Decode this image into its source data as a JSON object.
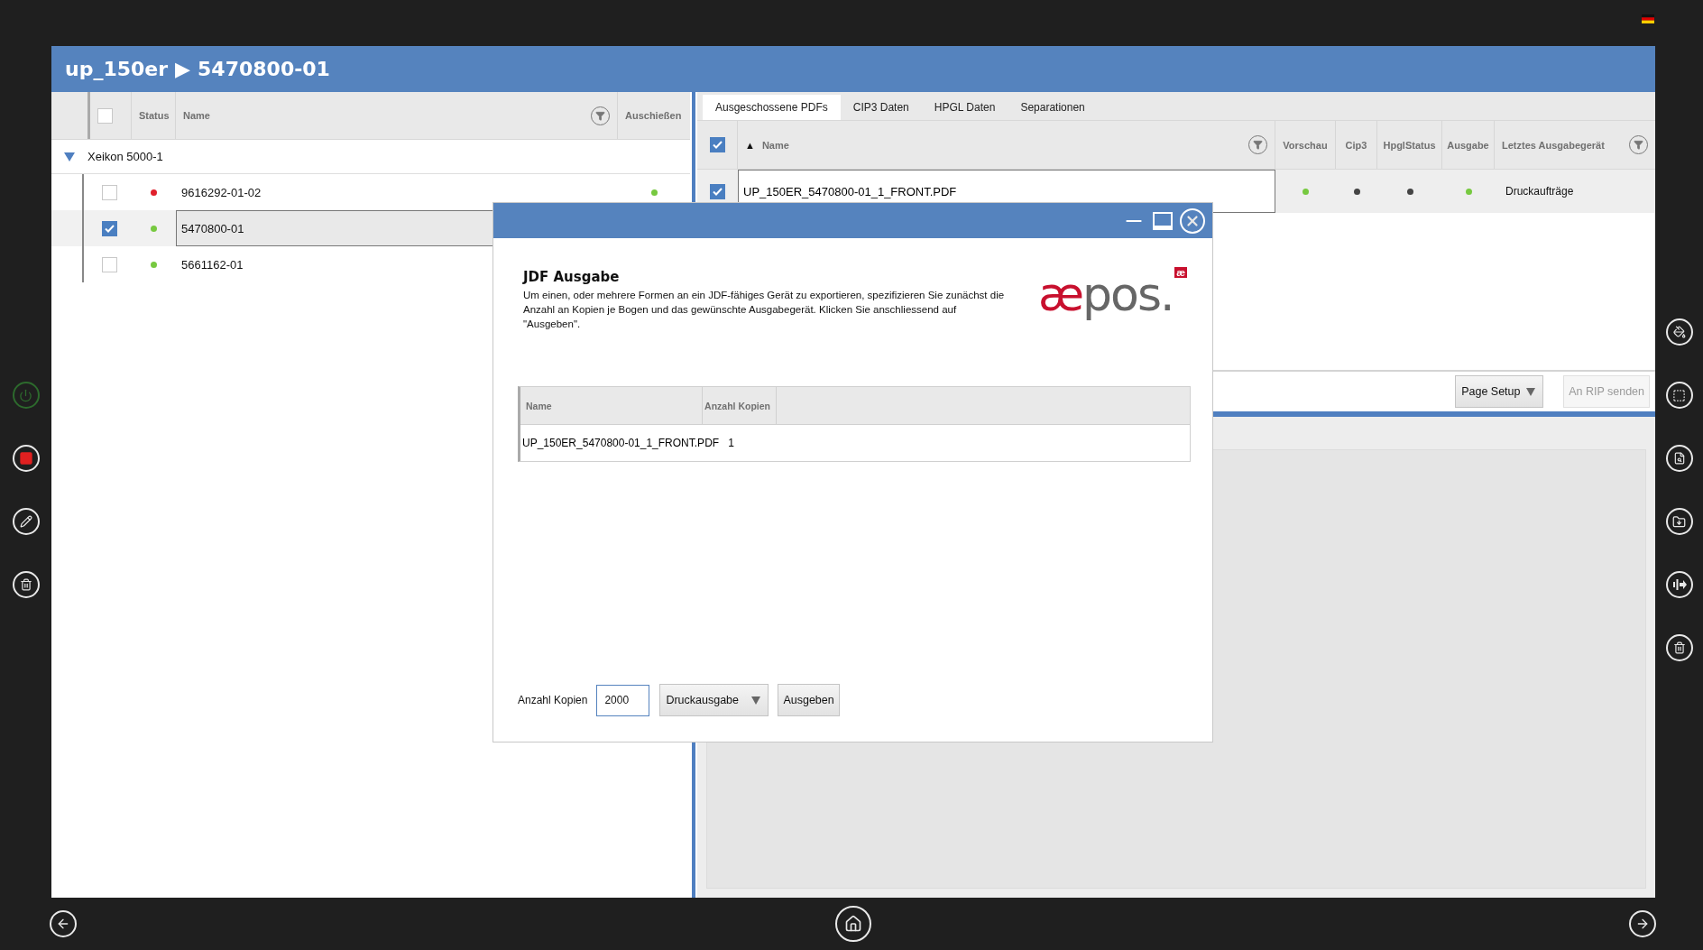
{
  "breadcrumb": {
    "project": "up_150er",
    "separator": "▶",
    "job": "5470800-01"
  },
  "left_table": {
    "all_checked": false,
    "columns": [
      "Status",
      "Name",
      "Auschießen"
    ],
    "groups": [
      {
        "name": "Xeikon 5000-1",
        "expanded": true,
        "rows": [
          {
            "checked": false,
            "color": "#e0202c",
            "name": "9616292-01-02",
            "selected": false,
            "imposed": {
              "color": "#77c940"
            }
          },
          {
            "checked": true,
            "color": "#77c940",
            "name": "5470800-01",
            "selected": true
          },
          {
            "checked": false,
            "color": "#77c940",
            "name": "5661162-01",
            "selected": false
          }
        ]
      }
    ]
  },
  "tabs": [
    {
      "label": "Ausgeschossene PDFs",
      "selected": true
    },
    {
      "label": "CIP3 Daten",
      "selected": false
    },
    {
      "label": "HPGL Daten",
      "selected": false
    },
    {
      "label": "Separationen",
      "selected": false
    }
  ],
  "pdf_table": {
    "all_checked": true,
    "name_column": "Name",
    "sort": "▲",
    "columns": [
      "Vorschau",
      "Cip3",
      "HpglStatus",
      "Ausgabe",
      "Letztes Ausgabegerät"
    ],
    "rows": [
      {
        "checked": true,
        "name": "UP_150ER_5470800-01_1_FRONT.PDF",
        "dots": [
          {
            "color": "#77c940"
          },
          {
            "color": "#444444"
          },
          {
            "color": "#444444"
          },
          {
            "color": "#77c940"
          }
        ],
        "last_device": "Druckaufträge"
      }
    ]
  },
  "toolbar": {
    "page_setup": "Page Setup",
    "send": {
      "label": "An RIP senden",
      "disabled": true
    }
  },
  "dialog": {
    "title": "JDF Ausgabe",
    "description": "Um einen, oder mehrere Formen an ein JDF-fähiges Gerät zu exportieren, spezifizieren Sie zunächst die Anzahl an Kopien je Bogen und das gewünschte Ausgabegerät. Klicken Sie anschliessend auf \"Ausgeben\".",
    "logo": {
      "mark": "æ",
      "word": "pos.",
      "badge": "æ"
    },
    "table": {
      "columns": [
        "Name",
        "Anzahl Kopien"
      ],
      "rows": [
        {
          "name": "UP_150ER_5470800-01_1_FRONT.PDF",
          "copies": "1"
        }
      ]
    },
    "copies_label": "Anzahl Kopien",
    "copies_value": "2000",
    "device": "Druckausgabe",
    "submit": "Ausgeben"
  }
}
